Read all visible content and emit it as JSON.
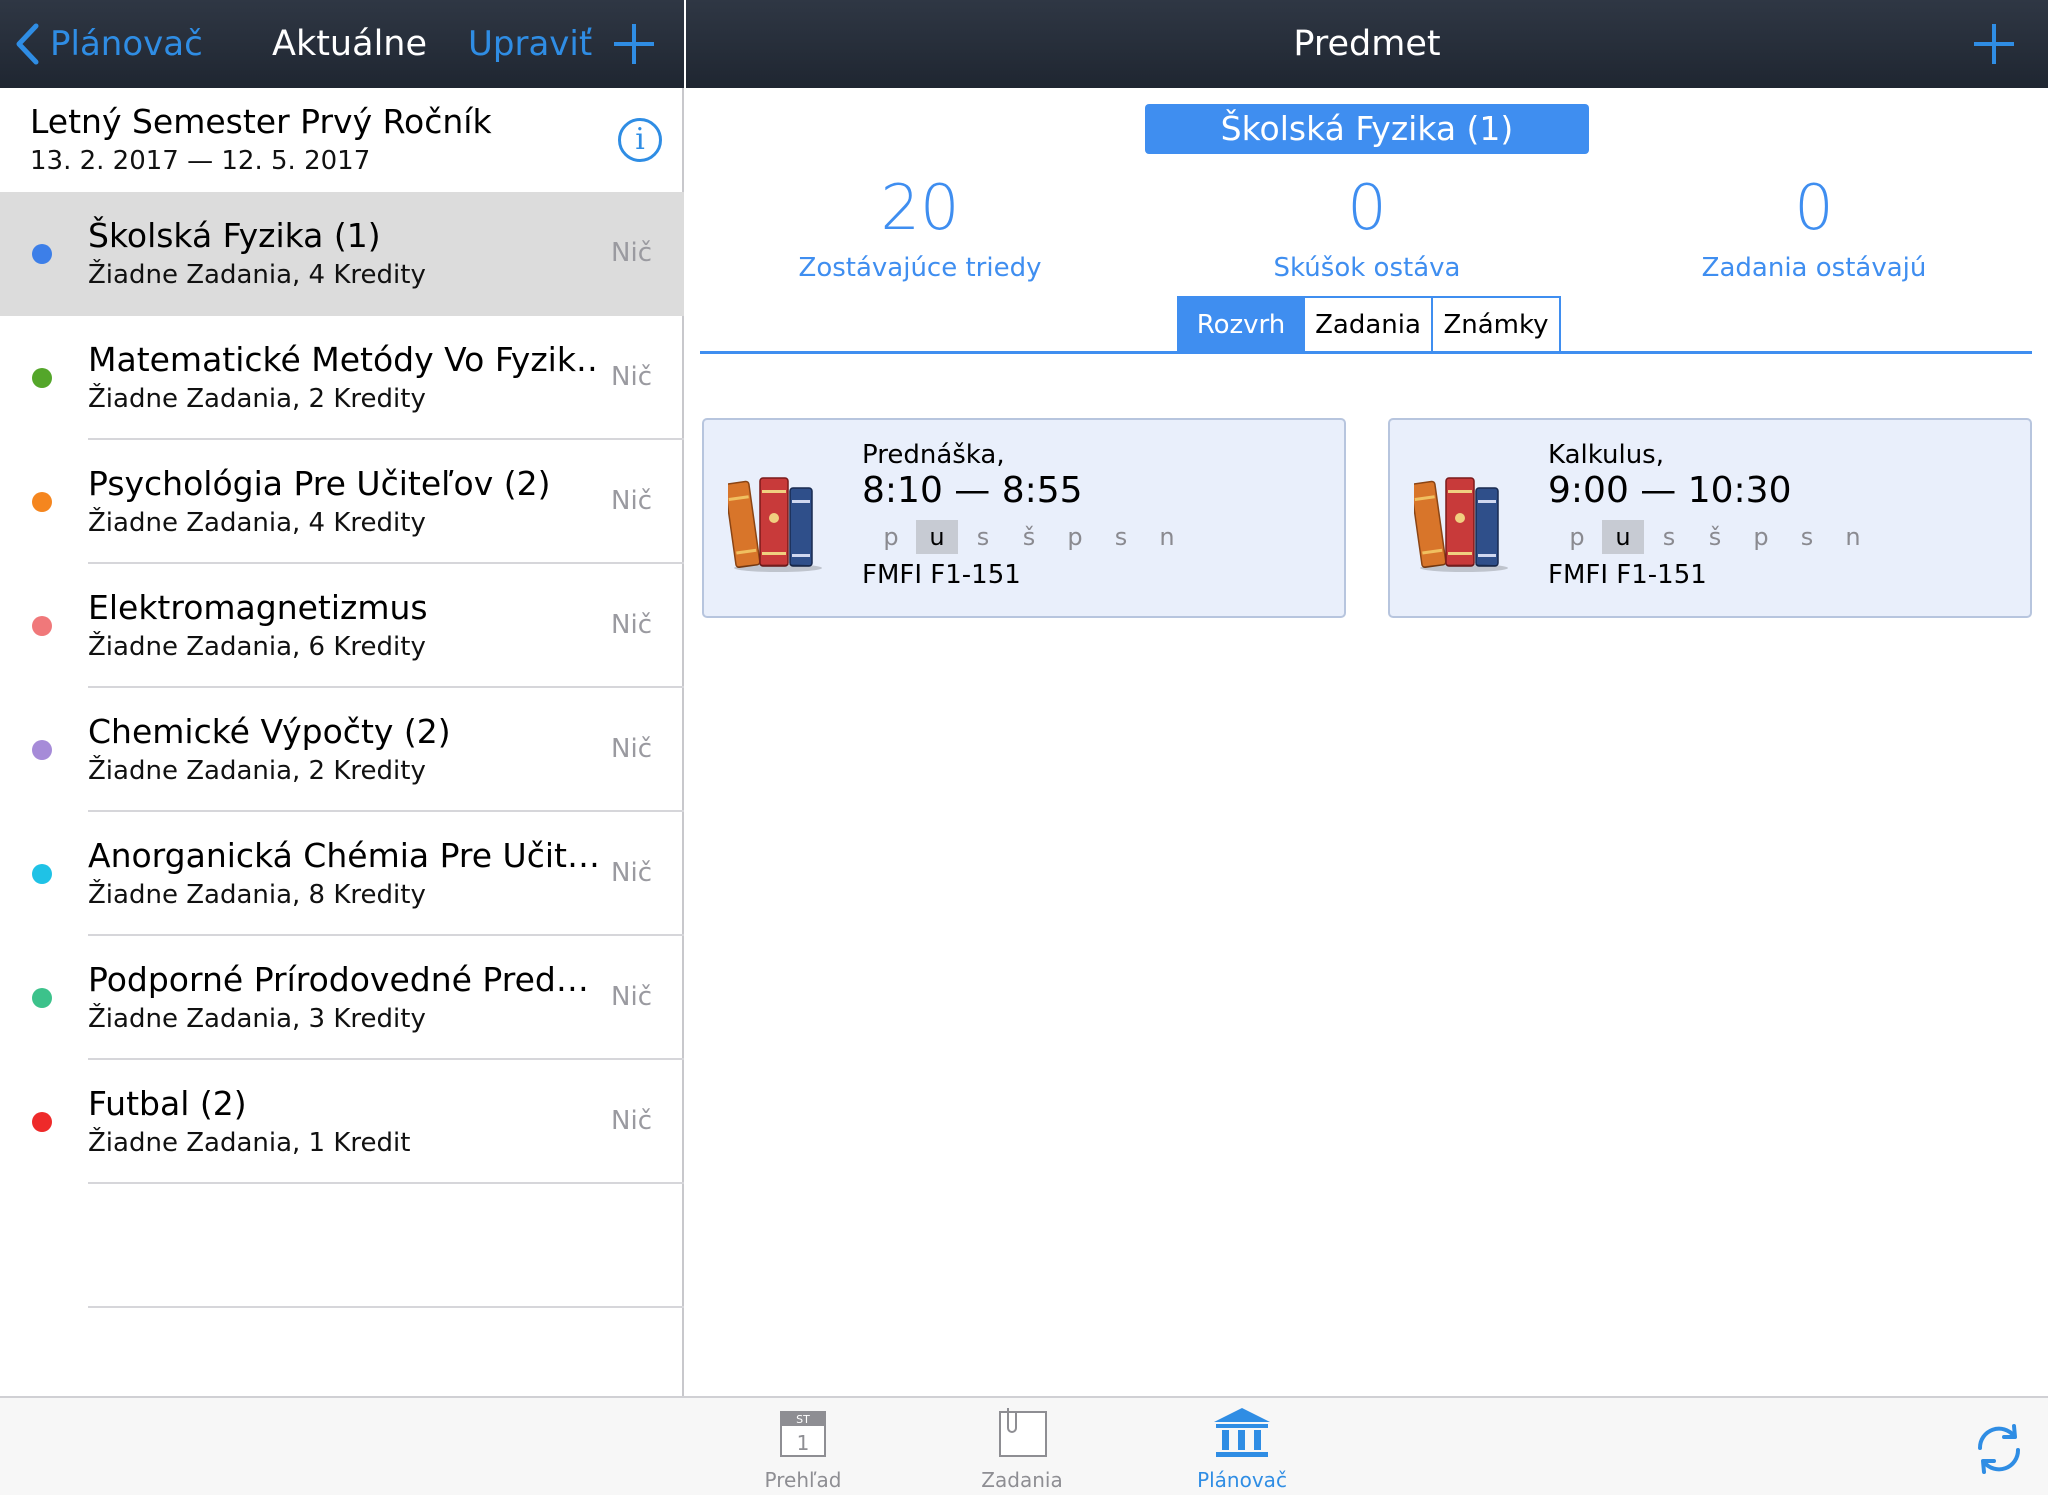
{
  "colors": {
    "accent": "#2f8de4",
    "badge": "#3f8ef0",
    "navbar": "#262d38",
    "selected_row": "#dcdcdc"
  },
  "left_nav": {
    "back_label": "Plánovač",
    "title": "Aktuálne",
    "edit_label": "Upraviť"
  },
  "semester": {
    "title": "Letný Semester Prvý Ročník",
    "dates": "13. 2. 2017 — 12. 5. 2017"
  },
  "subjects": [
    {
      "title": "Školská Fyzika (1)",
      "subtitle": "Žiadne Zadania, 4 Kredity",
      "right": "Nič",
      "color": "#3d7fe8"
    },
    {
      "title": "Matematické Metódy Vo Fyzik…",
      "subtitle": "Žiadne Zadania, 2 Kredity",
      "right": "Nič",
      "color": "#54a62a"
    },
    {
      "title": "Psychológia Pre Učiteľov (2)",
      "subtitle": "Žiadne Zadania, 4 Kredity",
      "right": "Nič",
      "color": "#f5861f"
    },
    {
      "title": "Elektromagnetizmus",
      "subtitle": "Žiadne Zadania, 6 Kredity",
      "right": "Nič",
      "color": "#f0787a"
    },
    {
      "title": "Chemické Výpočty (2)",
      "subtitle": "Žiadne Zadania, 2 Kredity",
      "right": "Nič",
      "color": "#a68bd8"
    },
    {
      "title": "Anorganická Chémia Pre Učit…",
      "subtitle": "Žiadne Zadania, 8 Kredity",
      "right": "Nič",
      "color": "#1fc2e6"
    },
    {
      "title": "Podporné Prírodovedné Pred…",
      "subtitle": "Žiadne Zadania, 3 Kredity",
      "right": "Nič",
      "color": "#3cc28b"
    },
    {
      "title": "Futbal (2)",
      "subtitle": "Žiadne Zadania, 1 Kredit",
      "right": "Nič",
      "color": "#ee2a2a"
    }
  ],
  "right_nav": {
    "title": "Predmet"
  },
  "subject": {
    "name": "Školská Fyzika (1)"
  },
  "stats": [
    {
      "value": "20",
      "label": "Zostávajúce triedy"
    },
    {
      "value": "0",
      "label": "Skúšok ostáva"
    },
    {
      "value": "0",
      "label": "Zadania ostávajú"
    }
  ],
  "tabs": [
    {
      "label": "Rozvrh",
      "active": true
    },
    {
      "label": "Zadania",
      "active": false
    },
    {
      "label": "Známky",
      "active": false
    }
  ],
  "schedule": [
    {
      "type": "Prednáška,",
      "time": "8:10 — 8:55",
      "days": [
        "p",
        "u",
        "s",
        "š",
        "p",
        "s",
        "n"
      ],
      "active_day": 1,
      "room": "FMFI F1-151",
      "icon": "books-icon"
    },
    {
      "type": "Kalkulus,",
      "time": "9:00 — 10:30",
      "days": [
        "p",
        "u",
        "s",
        "š",
        "p",
        "s",
        "n"
      ],
      "active_day": 1,
      "room": "FMFI F1-151",
      "icon": "books-icon"
    }
  ],
  "tabbar": {
    "items": [
      {
        "label": "Prehľad",
        "icon": "calendar-icon",
        "active": false,
        "calendar_month": "ST",
        "calendar_day": "1"
      },
      {
        "label": "Zadania",
        "icon": "clipboard-icon",
        "active": false
      },
      {
        "label": "Plánovač",
        "icon": "institution-icon",
        "active": true
      }
    ],
    "refresh_icon": "refresh-icon"
  }
}
